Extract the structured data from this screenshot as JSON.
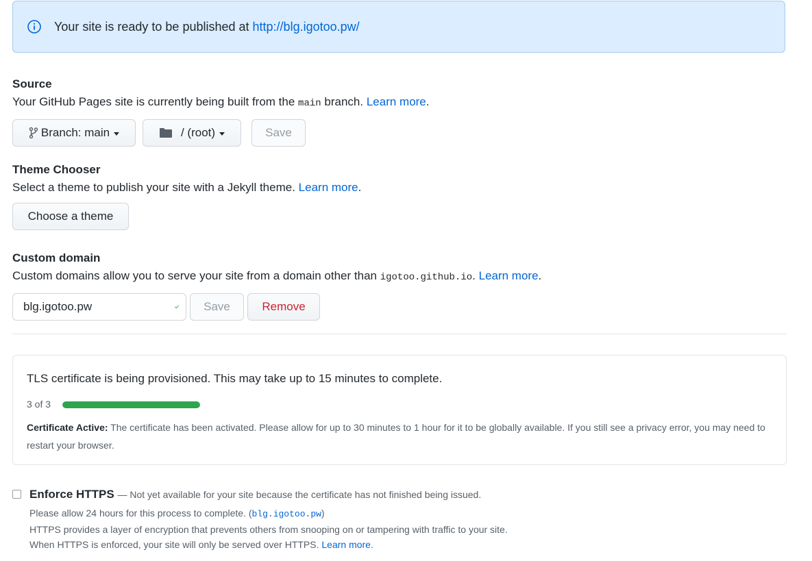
{
  "flash": {
    "text": "Your site is ready to be published at",
    "url": "http://blg.igotoo.pw/"
  },
  "source": {
    "title": "Source",
    "desc_before": "Your GitHub Pages site is currently being built from the",
    "branch_code": "main",
    "desc_after": "branch.",
    "learn_more": "Learn more",
    "branch_button": "Branch: main",
    "folder_button": "/ (root)",
    "save_button": "Save"
  },
  "theme": {
    "title": "Theme Chooser",
    "desc": "Select a theme to publish your site with a Jekyll theme.",
    "learn_more": "Learn more",
    "choose_button": "Choose a theme"
  },
  "custom_domain": {
    "title": "Custom domain",
    "desc_before": "Custom domains allow you to serve your site from a domain other than",
    "domain_code": "igotoo.github.io",
    "learn_more": "Learn more",
    "input_value": "blg.igotoo.pw",
    "save_button": "Save",
    "remove_button": "Remove"
  },
  "tls": {
    "title": "TLS certificate is being provisioned. This may take up to 15 minutes to complete.",
    "progress_label": "3 of 3",
    "progress_fraction": 1.0,
    "note_bold": "Certificate Active:",
    "note": "The certificate has been activated. Please allow for up to 30 minutes to 1 hour for it to be globally available. If you still see a privacy error, you may need to restart your browser."
  },
  "https": {
    "title": "Enforce HTTPS",
    "subtitle": "— Not yet available for your site because the certificate has not finished being issued.",
    "line1_before": "Please allow 24 hours for this process to complete. (",
    "line1_code": "blg.igotoo.pw",
    "line1_after": ")",
    "line2": "HTTPS provides a layer of encryption that prevents others from snooping on or tampering with traffic to your site.",
    "line3": "When HTTPS is enforced, your site will only be served over HTTPS.",
    "learn_more": "Learn more"
  },
  "colors": {
    "link": "#0366d6",
    "success": "#2ea44f",
    "danger": "#cb2431",
    "flash_bg": "#dbedff"
  }
}
